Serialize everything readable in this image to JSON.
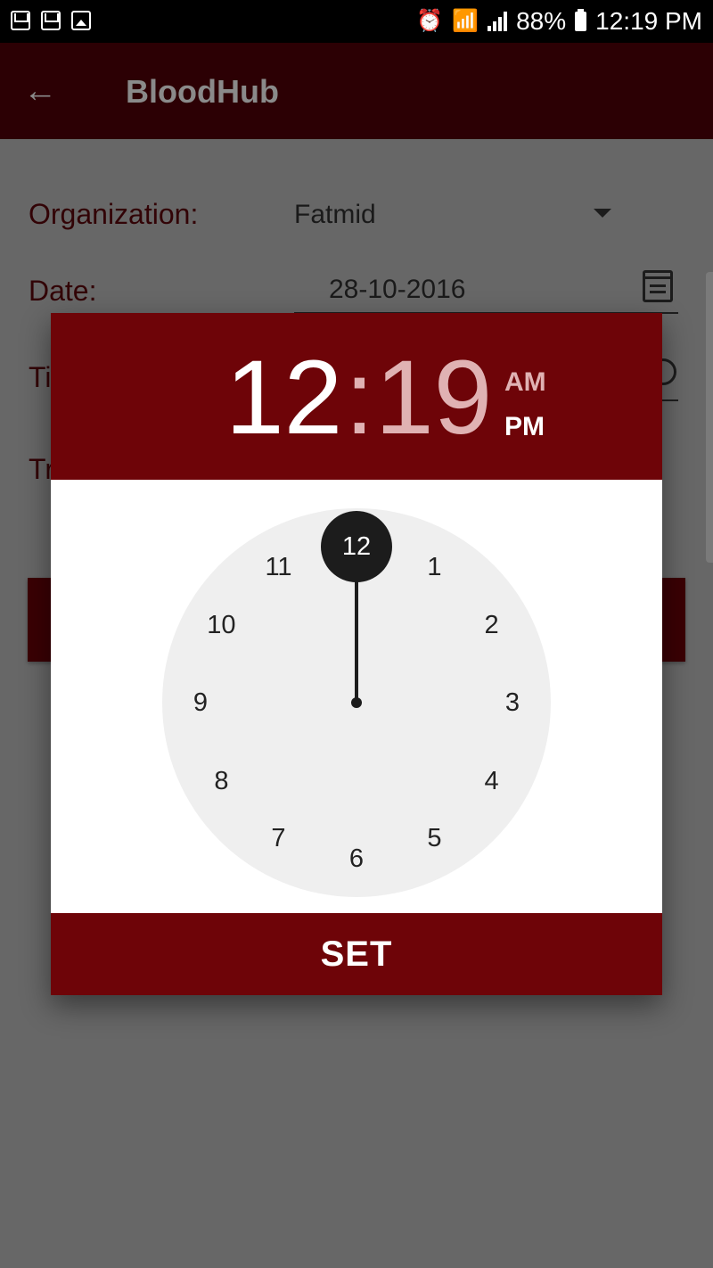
{
  "status_bar": {
    "icons": [
      "gmail-icon",
      "gmail-icon",
      "gallery-icon",
      "alarm-icon",
      "wifi-icon",
      "signal-icon",
      "battery-icon"
    ],
    "battery": "88%",
    "time": "12:19 PM"
  },
  "app_bar": {
    "title": "BloodHub",
    "back_icon": "arrow-back-icon"
  },
  "form": {
    "organization_label": "Organization:",
    "organization_value": "Fatmid",
    "date_label": "Date:",
    "date_value": "28-10-2016",
    "time_label_partial": "Ti",
    "third_label_partial": "Tr"
  },
  "time_picker": {
    "hour": "12",
    "separator": ":",
    "minute": "19",
    "am_label": "AM",
    "pm_label": "PM",
    "selected_period": "PM",
    "selected_hour": "12",
    "clock_numbers": [
      "12",
      "1",
      "2",
      "3",
      "4",
      "5",
      "6",
      "7",
      "8",
      "9",
      "10",
      "11"
    ],
    "set_label": "SET"
  },
  "colors": {
    "accent": "#6e0408",
    "appbar_dimmed": "#2c0004",
    "dial_bg": "#efefef",
    "hand": "#1c1c1c"
  }
}
